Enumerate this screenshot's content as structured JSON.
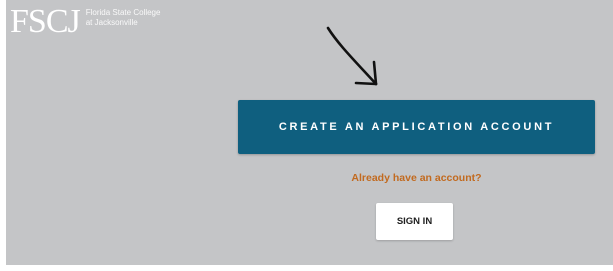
{
  "header": {
    "logo_mark": "FSCJ",
    "logo_line1": "Florida State College",
    "logo_line2": "at Jacksonville"
  },
  "main": {
    "create_account_label": "CREATE AN APPLICATION ACCOUNT",
    "already_account_text": "Already have an account?",
    "sign_in_label": "SIGN IN"
  },
  "colors": {
    "background": "#c4c5c7",
    "primary_button": "#0f5f7f",
    "link_accent": "#c26a1f",
    "secondary_button": "#ffffff"
  }
}
